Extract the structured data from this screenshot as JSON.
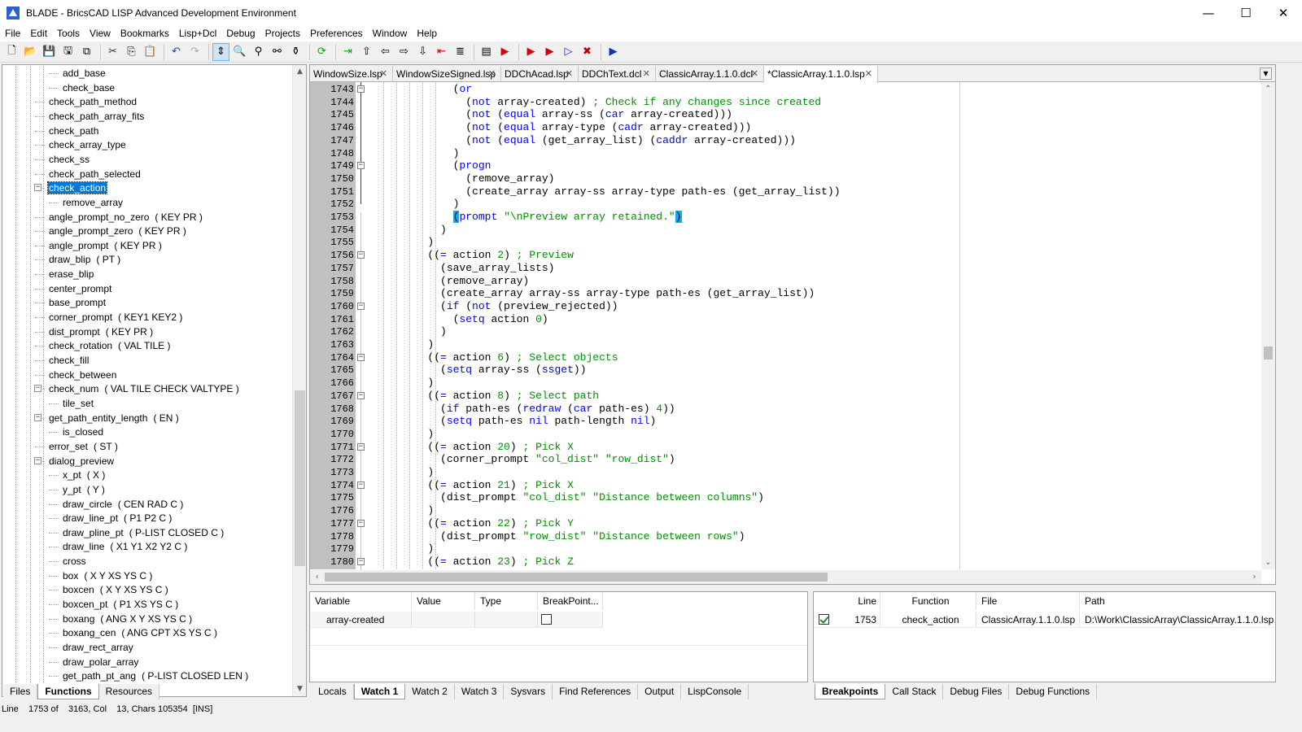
{
  "window": {
    "title": "BLADE - BricsCAD LISP Advanced Development Environment",
    "minimize": "—",
    "maximize": "☐",
    "close": "✕"
  },
  "menu": [
    "File",
    "Edit",
    "Tools",
    "View",
    "Bookmarks",
    "Lisp+Dcl",
    "Debug",
    "Projects",
    "Preferences",
    "Window",
    "Help"
  ],
  "toolbar_icons": [
    "new-file-icon",
    "open-folder-icon",
    "save-icon",
    "save-as-icon",
    "save-all-icon",
    "cut-icon",
    "copy-icon",
    "paste-icon",
    "undo-icon",
    "redo-icon",
    "toggle-icon",
    "find-icon",
    "find-next-icon",
    "find-all-icon",
    "goto-icon",
    "load-icon",
    "step-into-icon",
    "step-out-icon",
    "step-back-icon",
    "step-forward-icon",
    "step-down-icon",
    "break-icon",
    "format-icon",
    "comment-icon",
    "debug-icon",
    "run-icon",
    "run-to-icon",
    "continue-icon",
    "stop-icon",
    "execute-icon"
  ],
  "tree": {
    "items": [
      {
        "label": "add_base",
        "args": "",
        "level": 2
      },
      {
        "label": "check_base",
        "args": "",
        "level": 2
      },
      {
        "label": "check_path_method",
        "args": "",
        "level": 1
      },
      {
        "label": "check_path_array_fits",
        "args": "",
        "level": 1
      },
      {
        "label": "check_path",
        "args": "",
        "level": 1
      },
      {
        "label": "check_array_type",
        "args": "",
        "level": 1
      },
      {
        "label": "check_ss",
        "args": "",
        "level": 1
      },
      {
        "label": "check_path_selected",
        "args": "",
        "level": 1
      },
      {
        "label": "check_action",
        "args": "",
        "level": 1,
        "selected": true,
        "expand": true
      },
      {
        "label": "remove_array",
        "args": "",
        "level": 2
      },
      {
        "label": "angle_prompt_no_zero",
        "args": "( KEY PR )",
        "level": 1
      },
      {
        "label": "angle_prompt_zero",
        "args": "( KEY PR )",
        "level": 1
      },
      {
        "label": "angle_prompt",
        "args": "( KEY PR )",
        "level": 1
      },
      {
        "label": "draw_blip",
        "args": "( PT )",
        "level": 1
      },
      {
        "label": "erase_blip",
        "args": "",
        "level": 1
      },
      {
        "label": "center_prompt",
        "args": "",
        "level": 1
      },
      {
        "label": "base_prompt",
        "args": "",
        "level": 1
      },
      {
        "label": "corner_prompt",
        "args": "( KEY1 KEY2 )",
        "level": 1
      },
      {
        "label": "dist_prompt",
        "args": "( KEY PR )",
        "level": 1
      },
      {
        "label": "check_rotation",
        "args": "( VAL TILE )",
        "level": 1
      },
      {
        "label": "check_fill",
        "args": "",
        "level": 1
      },
      {
        "label": "check_between",
        "args": "",
        "level": 1
      },
      {
        "label": "check_num",
        "args": "( VAL TILE CHECK VALTYPE )",
        "level": 1,
        "expand": true
      },
      {
        "label": "tile_set",
        "args": "",
        "level": 2
      },
      {
        "label": "get_path_entity_length",
        "args": "( EN )",
        "level": 1,
        "expand": true
      },
      {
        "label": "is_closed",
        "args": "",
        "level": 2
      },
      {
        "label": "error_set",
        "args": "( ST )",
        "level": 1
      },
      {
        "label": "dialog_preview",
        "args": "",
        "level": 1,
        "expand": true
      },
      {
        "label": "x_pt",
        "args": "( X )",
        "level": 2
      },
      {
        "label": "y_pt",
        "args": "( Y )",
        "level": 2
      },
      {
        "label": "draw_circle",
        "args": "( CEN RAD C )",
        "level": 2
      },
      {
        "label": "draw_line_pt",
        "args": "( P1 P2 C )",
        "level": 2
      },
      {
        "label": "draw_pline_pt",
        "args": "( P-LIST CLOSED C )",
        "level": 2
      },
      {
        "label": "draw_line",
        "args": "( X1 Y1 X2 Y2 C )",
        "level": 2
      },
      {
        "label": "cross",
        "args": "",
        "level": 2
      },
      {
        "label": "box",
        "args": "( X Y XS YS C )",
        "level": 2
      },
      {
        "label": "boxcen",
        "args": "( X Y XS YS C )",
        "level": 2
      },
      {
        "label": "boxcen_pt",
        "args": "( P1 XS YS C )",
        "level": 2
      },
      {
        "label": "boxang",
        "args": "( ANG X Y XS YS C )",
        "level": 2
      },
      {
        "label": "boxang_cen",
        "args": "( ANG CPT XS YS C )",
        "level": 2
      },
      {
        "label": "draw_rect_array",
        "args": "",
        "level": 2
      },
      {
        "label": "draw_polar_array",
        "args": "",
        "level": 2
      },
      {
        "label": "get_path_pt_ang",
        "args": "( P-LIST CLOSED LEN )",
        "level": 2
      }
    ]
  },
  "left_tabs": [
    "Files",
    "Functions",
    "Resources"
  ],
  "left_active_tab": "Functions",
  "file_tabs": [
    {
      "label": "WindowSize.lsp",
      "active": false
    },
    {
      "label": "WindowSizeSigned.lsp",
      "active": false
    },
    {
      "label": "DDChAcad.lsp",
      "active": false
    },
    {
      "label": "DDChText.dcl",
      "active": false
    },
    {
      "label": "ClassicArray.1.1.0.dcl",
      "active": false
    },
    {
      "label": "*ClassicArray.1.1.0.lsp",
      "active": true
    }
  ],
  "code_lines": [
    {
      "n": "1743",
      "t": [
        [
          "            ",
          ""
        ],
        [
          "(",
          "p"
        ],
        [
          "or",
          "kw"
        ]
      ],
      "fold": "-"
    },
    {
      "n": "1744",
      "t": [
        [
          "              (",
          "p"
        ],
        [
          "not",
          "kw"
        ],
        [
          " array-created) ",
          ""
        ],
        [
          "; Check if any changes since created",
          "cm"
        ]
      ]
    },
    {
      "n": "1745",
      "t": [
        [
          "              (",
          "p"
        ],
        [
          "not",
          "kw"
        ],
        [
          " (",
          ""
        ],
        [
          "equal",
          "kw"
        ],
        [
          " array-ss (",
          ""
        ],
        [
          "car",
          "kw"
        ],
        [
          " array-created)))",
          ""
        ]
      ]
    },
    {
      "n": "1746",
      "t": [
        [
          "              (",
          "p"
        ],
        [
          "not",
          "kw"
        ],
        [
          " (",
          ""
        ],
        [
          "equal",
          "kw"
        ],
        [
          " array-type (",
          ""
        ],
        [
          "cadr",
          "kw"
        ],
        [
          " array-created)))",
          ""
        ]
      ]
    },
    {
      "n": "1747",
      "t": [
        [
          "              (",
          "p"
        ],
        [
          "not",
          "kw"
        ],
        [
          " (",
          ""
        ],
        [
          "equal",
          "kw"
        ],
        [
          " (get_array_list) (",
          ""
        ],
        [
          "caddr",
          "kw"
        ],
        [
          " array-created)))",
          ""
        ]
      ]
    },
    {
      "n": "1748",
      "t": [
        [
          "            )",
          ""
        ]
      ]
    },
    {
      "n": "1749",
      "t": [
        [
          "            (",
          "p"
        ],
        [
          "progn",
          "kw"
        ]
      ],
      "fold": "-"
    },
    {
      "n": "1750",
      "t": [
        [
          "              (remove_array)",
          ""
        ]
      ]
    },
    {
      "n": "1751",
      "t": [
        [
          "              (create_array array-ss array-type path-es (get_array_list))",
          ""
        ]
      ]
    },
    {
      "n": "1752",
      "t": [
        [
          "            )",
          ""
        ]
      ]
    },
    {
      "n": "1753",
      "t": [
        [
          "            ",
          ""
        ],
        [
          "(",
          "hl"
        ],
        [
          "prompt",
          "kw"
        ],
        [
          " ",
          ""
        ],
        [
          "\"\\nPreview array retained.\"",
          "st"
        ],
        [
          ")",
          "hl"
        ]
      ],
      "bp": true
    },
    {
      "n": "1754",
      "t": [
        [
          "          )",
          ""
        ]
      ]
    },
    {
      "n": "1755",
      "t": [
        [
          "        )",
          ""
        ]
      ]
    },
    {
      "n": "1756",
      "t": [
        [
          "        ((",
          ""
        ],
        [
          "=",
          "kw"
        ],
        [
          " action ",
          ""
        ],
        [
          "2",
          "num"
        ],
        [
          ") ",
          ""
        ],
        [
          "; Preview",
          "cm"
        ]
      ],
      "fold": "-"
    },
    {
      "n": "1757",
      "t": [
        [
          "          (save_array_lists)",
          ""
        ]
      ]
    },
    {
      "n": "1758",
      "t": [
        [
          "          (remove_array)",
          ""
        ]
      ]
    },
    {
      "n": "1759",
      "t": [
        [
          "          (create_array array-ss array-type path-es (get_array_list))",
          ""
        ]
      ]
    },
    {
      "n": "1760",
      "t": [
        [
          "          (",
          ""
        ],
        [
          "if",
          "kw"
        ],
        [
          " (",
          ""
        ],
        [
          "not",
          "kw"
        ],
        [
          " (preview_rejected))",
          ""
        ]
      ],
      "fold": "-"
    },
    {
      "n": "1761",
      "t": [
        [
          "            (",
          ""
        ],
        [
          "setq",
          "kw"
        ],
        [
          " action ",
          ""
        ],
        [
          "0",
          "num"
        ],
        [
          ")",
          ""
        ]
      ]
    },
    {
      "n": "1762",
      "t": [
        [
          "          )",
          ""
        ]
      ]
    },
    {
      "n": "1763",
      "t": [
        [
          "        )",
          ""
        ]
      ]
    },
    {
      "n": "1764",
      "t": [
        [
          "        ((",
          ""
        ],
        [
          "=",
          "kw"
        ],
        [
          " action ",
          ""
        ],
        [
          "6",
          "num"
        ],
        [
          ") ",
          ""
        ],
        [
          "; Select objects",
          "cm"
        ]
      ],
      "fold": "-"
    },
    {
      "n": "1765",
      "t": [
        [
          "          (",
          ""
        ],
        [
          "setq",
          "kw"
        ],
        [
          " array-ss (",
          ""
        ],
        [
          "ssget",
          "kw"
        ],
        [
          "))",
          ""
        ]
      ]
    },
    {
      "n": "1766",
      "t": [
        [
          "        )",
          ""
        ]
      ]
    },
    {
      "n": "1767",
      "t": [
        [
          "        ((",
          ""
        ],
        [
          "=",
          "kw"
        ],
        [
          " action ",
          ""
        ],
        [
          "8",
          "num"
        ],
        [
          ") ",
          ""
        ],
        [
          "; Select path",
          "cm"
        ]
      ],
      "fold": "-"
    },
    {
      "n": "1768",
      "t": [
        [
          "          (",
          ""
        ],
        [
          "if",
          "kw"
        ],
        [
          " path-es (",
          ""
        ],
        [
          "redraw",
          "kw"
        ],
        [
          " (",
          ""
        ],
        [
          "car",
          "kw"
        ],
        [
          " path-es) ",
          ""
        ],
        [
          "4",
          "num"
        ],
        [
          "))",
          ""
        ]
      ]
    },
    {
      "n": "1769",
      "t": [
        [
          "          (",
          ""
        ],
        [
          "setq",
          "kw"
        ],
        [
          " path-es ",
          ""
        ],
        [
          "nil",
          "kw"
        ],
        [
          " path-length ",
          ""
        ],
        [
          "nil",
          "kw"
        ],
        [
          ")",
          ""
        ]
      ]
    },
    {
      "n": "1770",
      "t": [
        [
          "        )",
          ""
        ]
      ]
    },
    {
      "n": "1771",
      "t": [
        [
          "        ((",
          ""
        ],
        [
          "=",
          "kw"
        ],
        [
          " action ",
          ""
        ],
        [
          "20",
          "num"
        ],
        [
          ") ",
          ""
        ],
        [
          "; Pick X",
          "cm"
        ]
      ],
      "fold": "-"
    },
    {
      "n": "1772",
      "t": [
        [
          "          (corner_prompt ",
          ""
        ],
        [
          "\"col_dist\"",
          "st"
        ],
        [
          " ",
          ""
        ],
        [
          "\"row_dist\"",
          "st"
        ],
        [
          ")",
          ""
        ]
      ]
    },
    {
      "n": "1773",
      "t": [
        [
          "        )",
          ""
        ]
      ]
    },
    {
      "n": "1774",
      "t": [
        [
          "        ((",
          ""
        ],
        [
          "=",
          "kw"
        ],
        [
          " action ",
          ""
        ],
        [
          "21",
          "num"
        ],
        [
          ") ",
          ""
        ],
        [
          "; Pick X",
          "cm"
        ]
      ],
      "fold": "-"
    },
    {
      "n": "1775",
      "t": [
        [
          "          (dist_prompt ",
          ""
        ],
        [
          "\"col_dist\"",
          "st"
        ],
        [
          " ",
          ""
        ],
        [
          "\"Distance between columns\"",
          "st"
        ],
        [
          ")",
          ""
        ]
      ]
    },
    {
      "n": "1776",
      "t": [
        [
          "        )",
          ""
        ]
      ]
    },
    {
      "n": "1777",
      "t": [
        [
          "        ((",
          ""
        ],
        [
          "=",
          "kw"
        ],
        [
          " action ",
          ""
        ],
        [
          "22",
          "num"
        ],
        [
          ") ",
          ""
        ],
        [
          "; Pick Y",
          "cm"
        ]
      ],
      "fold": "-"
    },
    {
      "n": "1778",
      "t": [
        [
          "          (dist_prompt ",
          ""
        ],
        [
          "\"row_dist\"",
          "st"
        ],
        [
          " ",
          ""
        ],
        [
          "\"Distance between rows\"",
          "st"
        ],
        [
          ")",
          ""
        ]
      ]
    },
    {
      "n": "1779",
      "t": [
        [
          "        )",
          ""
        ]
      ]
    },
    {
      "n": "1780",
      "t": [
        [
          "        ((",
          ""
        ],
        [
          "=",
          "kw"
        ],
        [
          " action ",
          ""
        ],
        [
          "23",
          "num"
        ],
        [
          ") ",
          ""
        ],
        [
          "; Pick Z",
          "cm"
        ]
      ],
      "fold": "-"
    }
  ],
  "watch": {
    "headers": [
      "Variable",
      "Value",
      "Type",
      "BreakPoint..."
    ],
    "rows": [
      {
        "variable": "array-created",
        "value": "",
        "type": "",
        "breakpoint": false
      }
    ]
  },
  "watch_tabs": [
    "Locals",
    "Watch 1",
    "Watch 2",
    "Watch 3",
    "Sysvars",
    "Find References",
    "Output",
    "LispConsole"
  ],
  "watch_active_tab": "Watch 1",
  "breakpoints": {
    "headers": [
      "Line",
      "Function",
      "File",
      "Path"
    ],
    "rows": [
      {
        "enabled": true,
        "line": "1753",
        "function": "check_action",
        "file": "ClassicArray.1.1.0.lsp",
        "path": "D:\\Work\\ClassicArray\\ClassicArray.1.1.0.lsp"
      }
    ]
  },
  "bp_tabs": [
    "Breakpoints",
    "Call Stack",
    "Debug Files",
    "Debug Functions"
  ],
  "bp_active_tab": "Breakpoints",
  "status": {
    "text": "Line    1753 of    3163, Col    13, Chars 105354  [INS]"
  }
}
